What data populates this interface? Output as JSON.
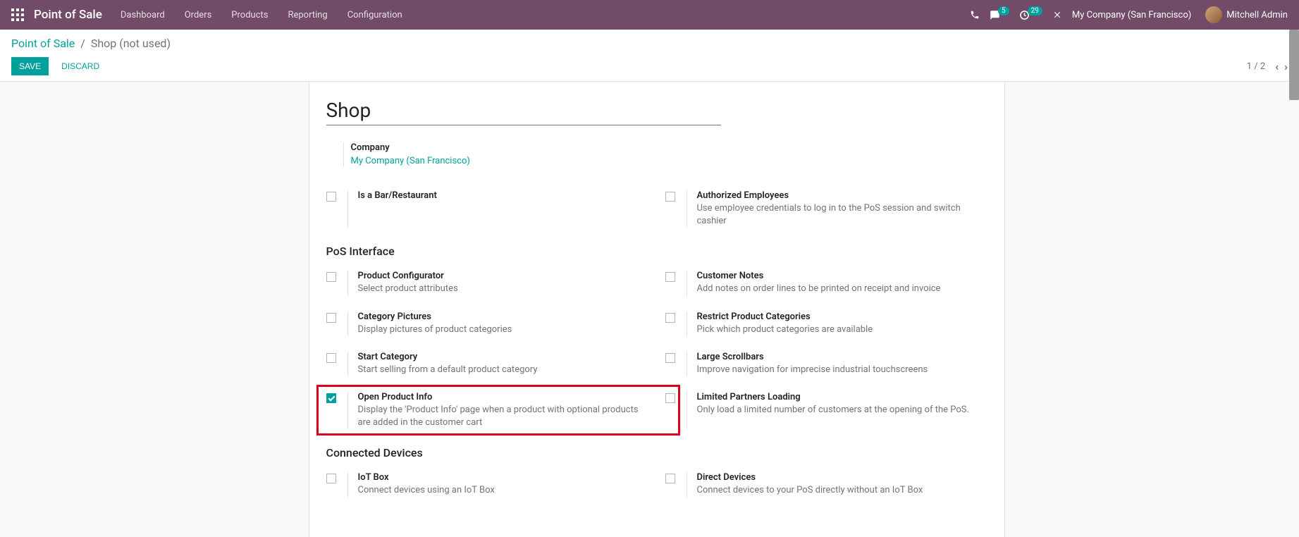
{
  "nav": {
    "brand": "Point of Sale",
    "items": [
      "Dashboard",
      "Orders",
      "Products",
      "Reporting",
      "Configuration"
    ],
    "badge_messages": "5",
    "badge_activities": "29",
    "company": "My Company (San Francisco)",
    "user": "Mitchell Admin"
  },
  "breadcrumb": {
    "parent": "Point of Sale",
    "current": "Shop (not used)"
  },
  "buttons": {
    "save": "SAVE",
    "discard": "DISCARD"
  },
  "pager": "1 / 2",
  "page_title": "Shop",
  "company_block": {
    "label": "Company",
    "value": "My Company (San Francisco)"
  },
  "sections": {
    "pos_interface": "PoS Interface",
    "connected_devices": "Connected Devices"
  },
  "settings": {
    "bar_restaurant": {
      "label": "Is a Bar/Restaurant",
      "desc": ""
    },
    "authorized_employees": {
      "label": "Authorized Employees",
      "desc": "Use employee credentials to log in to the PoS session and switch cashier"
    },
    "product_configurator": {
      "label": "Product Configurator",
      "desc": "Select product attributes"
    },
    "customer_notes": {
      "label": "Customer Notes",
      "desc": "Add notes on order lines to be printed on receipt and invoice"
    },
    "category_pictures": {
      "label": "Category Pictures",
      "desc": "Display pictures of product categories"
    },
    "restrict_categories": {
      "label": "Restrict Product Categories",
      "desc": "Pick which product categories are available"
    },
    "start_category": {
      "label": "Start Category",
      "desc": "Start selling from a default product category"
    },
    "large_scrollbars": {
      "label": "Large Scrollbars",
      "desc": "Improve navigation for imprecise industrial touchscreens"
    },
    "open_product_info": {
      "label": "Open Product Info",
      "desc": "Display the 'Product Info' page when a product with optional products are added in the customer cart"
    },
    "limited_partners": {
      "label": "Limited Partners Loading",
      "desc": "Only load a limited number of customers at the opening of the PoS."
    },
    "iot_box": {
      "label": "IoT Box",
      "desc": "Connect devices using an IoT Box"
    },
    "direct_devices": {
      "label": "Direct Devices",
      "desc": "Connect devices to your PoS directly without an IoT Box"
    }
  }
}
